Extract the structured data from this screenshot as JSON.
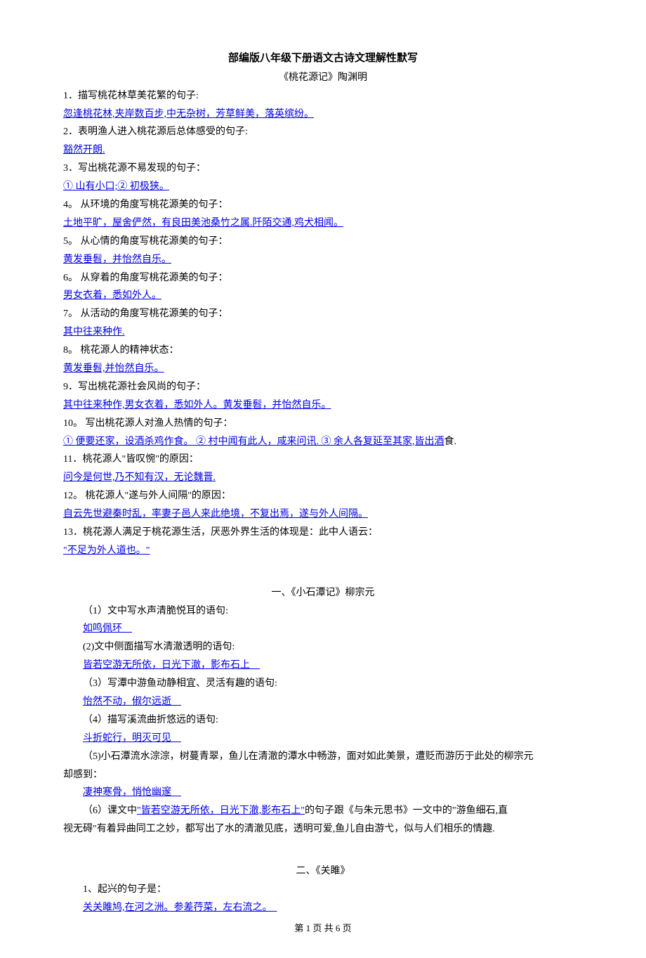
{
  "title": "部编版八年级下册语文古诗文理解性默写",
  "poem1_title": "《桃花源记》陶渊明",
  "q1": "1．描写桃花林草美花繁的句子:",
  "a1": "忽逢桃花林,夹岸数百步,中无杂树，芳草鲜美，落英缤纷。",
  "q2": "2．表明渔人进入桃花源后总体感受的句子:",
  "a2": "豁然开朗.",
  "q3": "3．写出桃花源不易发现的句子：",
  "a3": "① 山有小口;② 初极狭。",
  "q4": "4。 从环境的角度写桃花源美的句子：",
  "a4": "土地平旷，屋舍俨然，有良田美池桑竹之属.阡陌交通,鸡犬相闻。",
  "q5": "5。 从心情的角度写桃花源美的句子：",
  "a5": "黄发垂髫，并怡然自乐。",
  "q6": "6。 从穿着的角度写桃花源美的句子：",
  "a6": "男女衣着，悉如外人。",
  "q7": "7。 从活动的角度写桃花源美的句子：",
  "a7": "其中往来种作.",
  "q8": "8。 桃花源人的精神状态：",
  "a8": "黄发垂髫,并怡然自乐。",
  "q9": "9．写出桃花源社会风尚的句子：",
  "a9": "其中往来种作,男女衣着，悉如外人。黄发垂髫，并怡然自乐。",
  "q10": "10。 写出桃花源人对渔人热情的句子：",
  "a10a": "① 便要还家，设酒杀鸡作食。 ② 村中闻有此人，咸来问讯. ③ 余人各复延至其家,皆出酒",
  "a10b": "食.",
  "q11": "11．桃花源人\"皆叹惋\"的原因：",
  "a11": "问今是何世,乃不知有汉，无论魏晋.",
  "q12": "12。 桃花源人\"遂与外人间隔\"的原因：",
  "a12": "自云先世避秦时乱，率妻子邑人来此绝境，不复出焉，遂与外人间隔。",
  "q13": "13．桃花源人满足于桃花源生活，厌恶外界生活的体现是：此中人语云：",
  "a13": "\"不足为外人道也。\"",
  "section1_title": "一、《小石潭记》柳宗元",
  "s1q1": "（1）文中写水声清脆悦耳的语句:",
  "s1a1": "如鸣佩环　",
  "s1q2": "(2)文中侧面描写水清澈透明的语句:",
  "s1a2": "皆若空游无所依，日光下澈，影布石上　",
  "s1q3": "（3）写潭中游鱼动静相宜、灵活有趣的语句:",
  "s1a3": "怡然不动，俶尔远逝　",
  "s1q4": "（4）描写溪流曲折悠远的语句:",
  "s1a4": "斗折蛇行，明灭可见　",
  "s1q5a": "（5)小石潭流水淙淙，树蔓青翠，鱼儿在清澈的潭水中畅游，面对如此美景，遭贬而游历于此处的柳宗元",
  "s1q5b": "却感到：",
  "s1a5": "凄神寒骨，悄怆幽邃　",
  "s1q6a": "（6）课文中",
  "s1a6": "\"皆若空游无所依，日光下澈,影布石上\"",
  "s1q6b": "的句子跟《与朱元思书》一文中的\"游鱼细石,直",
  "s1q6c": "视无碍\"有着异曲同工之妙，都写出了水的清澈见底，透明可爱,鱼儿自由游弋，似与人们相乐的情趣.",
  "section2_title": "二、《关雎》",
  "s2q1": "1、起兴的句子是：",
  "s2a1": "关关雎鸠,在河之洲。参差荇菜，左右流之。　",
  "footer": "第 1 页 共 6 页"
}
